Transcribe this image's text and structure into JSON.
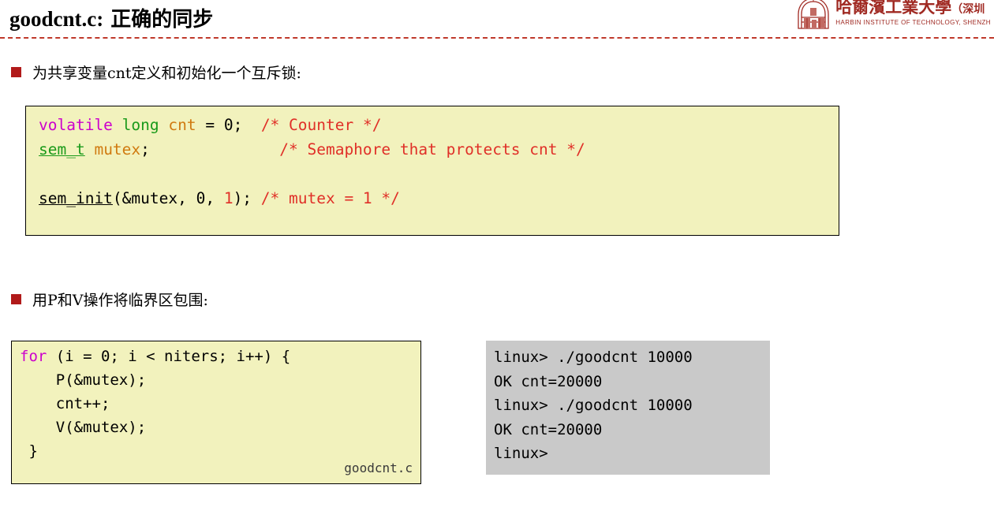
{
  "header": {
    "title_mono": "goodcnt.c:",
    "title_cjk": " 正确的同步",
    "logo": {
      "emblem_name": "hit-emblem-icon",
      "chinese": "哈爾濱工業大學",
      "chinese_paren": "（深圳",
      "english": "HARBIN INSTITUTE OF TECHNOLOGY, SHENZH",
      "color": "#a02a23"
    },
    "rule_color": "#c0392b"
  },
  "bullets": [
    {
      "id": "bullet-1",
      "text": "为共享变量cnt定义和初始化一个互斥锁:"
    },
    {
      "id": "bullet-2",
      "text": "用P和V操作将临界区包围:"
    }
  ],
  "code_block_1": {
    "background": "#f2f2bd",
    "lines": [
      [
        {
          "t": "volatile",
          "c": "kw-purple"
        },
        {
          "t": " ",
          "c": "kw-black"
        },
        {
          "t": "long",
          "c": "kw-green"
        },
        {
          "t": " ",
          "c": "kw-black"
        },
        {
          "t": "cnt",
          "c": "kw-orange"
        },
        {
          "t": " = 0;  ",
          "c": "kw-black"
        },
        {
          "t": "/* Counter */",
          "c": "kw-red"
        }
      ],
      [
        {
          "t": "sem_t",
          "c": "kw-green underline-t"
        },
        {
          "t": " ",
          "c": "kw-black"
        },
        {
          "t": "mutex",
          "c": "kw-orange"
        },
        {
          "t": ";              ",
          "c": "kw-black"
        },
        {
          "t": "/* Semaphore that protects cnt */",
          "c": "kw-red"
        }
      ],
      [],
      [
        {
          "t": "sem_init",
          "c": "kw-black underline-t"
        },
        {
          "t": "(&mutex, 0, ",
          "c": "kw-black"
        },
        {
          "t": "1",
          "c": "kw-red"
        },
        {
          "t": "); ",
          "c": "kw-black"
        },
        {
          "t": "/* mutex = 1 */",
          "c": "kw-red"
        }
      ]
    ]
  },
  "code_block_2": {
    "background": "#f2f2bd",
    "file_label": "goodcnt.c",
    "lines": [
      [
        {
          "t": "for",
          "c": "kw-purple"
        },
        {
          "t": " (i = 0; i < niters; i++) {",
          "c": "kw-black"
        }
      ],
      [
        {
          "t": "    P(&mutex);",
          "c": "kw-black"
        }
      ],
      [
        {
          "t": "    cnt++;",
          "c": "kw-black"
        }
      ],
      [
        {
          "t": "    V(&mutex);",
          "c": "kw-black"
        }
      ],
      [
        {
          "t": " }",
          "c": "kw-black"
        }
      ]
    ]
  },
  "terminal": {
    "background": "#c9c9c9",
    "lines": [
      "linux> ./goodcnt 10000",
      "OK cnt=20000",
      "linux> ./goodcnt 10000",
      "OK cnt=20000",
      "linux>"
    ]
  }
}
